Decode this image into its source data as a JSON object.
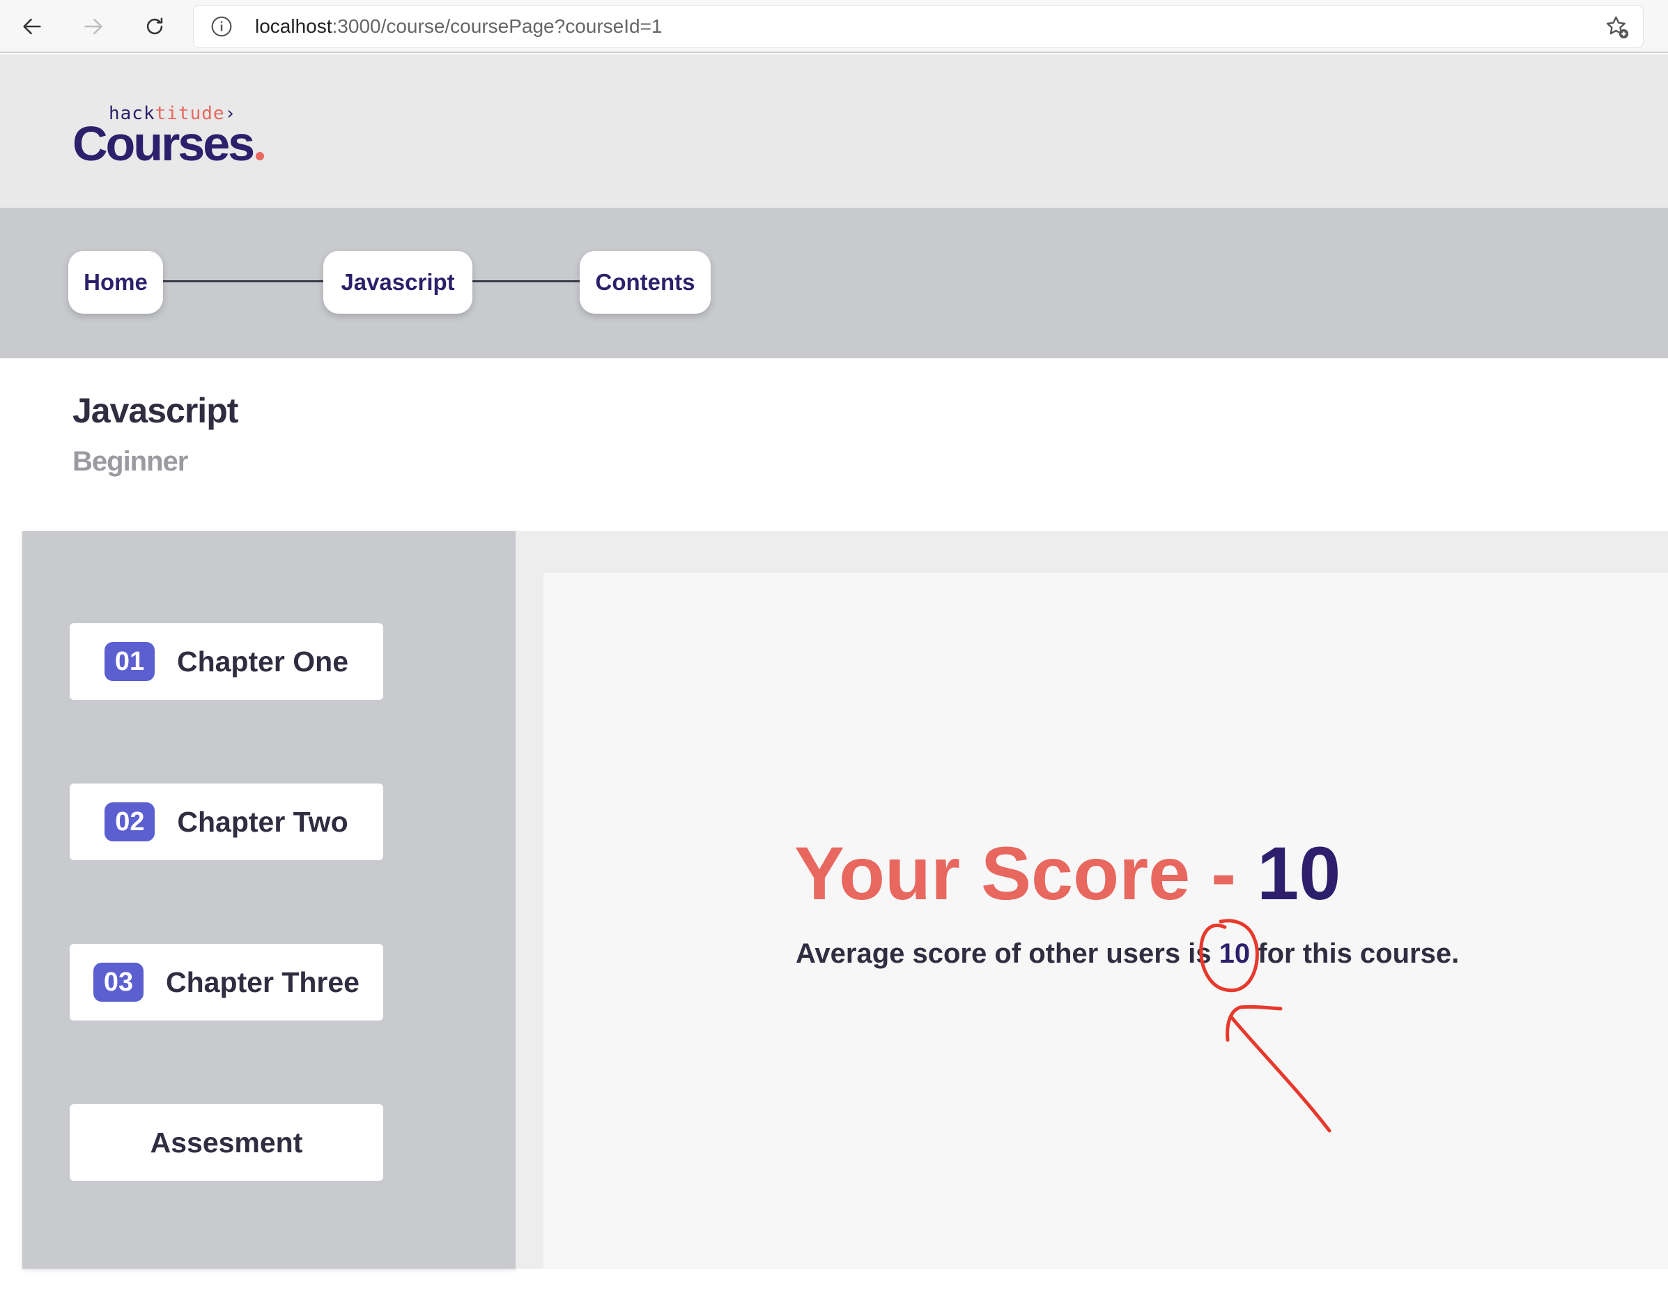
{
  "browser": {
    "url_host": "localhost",
    "url_rest": ":3000/course/coursePage?courseId=1",
    "icons": [
      "back-arrow-icon",
      "forward-arrow-icon",
      "reload-icon",
      "info-icon",
      "bookmark-star-icon"
    ]
  },
  "logo": {
    "top_a": "hack",
    "top_b": "titude",
    "top_c": "›",
    "main": "Courses"
  },
  "breadcrumb": [
    "Home",
    "Javascript",
    "Contents"
  ],
  "course": {
    "title": "Javascript",
    "level": "Beginner"
  },
  "chapters": [
    {
      "num": "01",
      "label": "Chapter One"
    },
    {
      "num": "02",
      "label": "Chapter Two"
    },
    {
      "num": "03",
      "label": "Chapter Three"
    }
  ],
  "assessment_label": "Assesment",
  "score": {
    "label": "Your Score - ",
    "value": "10",
    "avg_prefix": "Average score of other users is ",
    "avg_value": "10",
    "avg_suffix": " for this course."
  },
  "colors": {
    "brand_navy": "#2d1f6b",
    "accent_coral": "#e8675e",
    "chapter_badge": "#5b5fd0",
    "annotation_red": "#e8392c"
  }
}
